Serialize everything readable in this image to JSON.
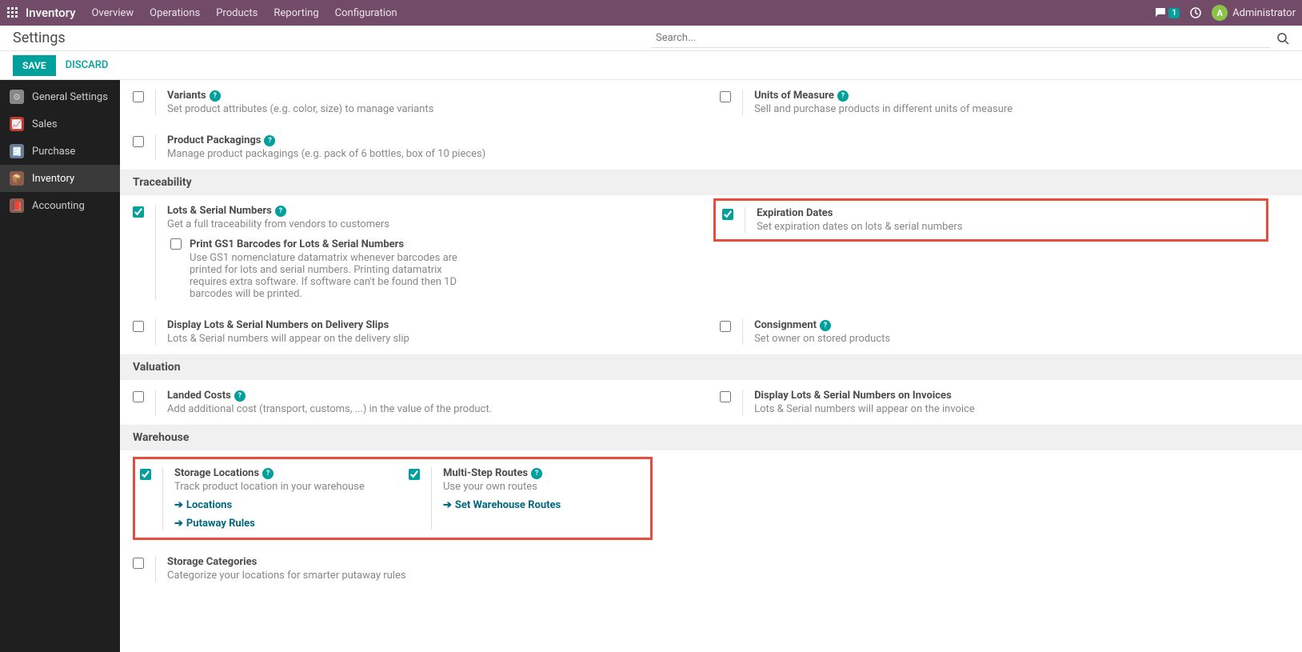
{
  "topbar": {
    "brand": "Inventory",
    "menu": [
      "Overview",
      "Operations",
      "Products",
      "Reporting",
      "Configuration"
    ],
    "badge_count": "1",
    "user": "Administrator",
    "avatar_letter": "A"
  },
  "page": {
    "title": "Settings",
    "search_placeholder": "Search..."
  },
  "actions": {
    "save": "SAVE",
    "discard": "DISCARD"
  },
  "sidebar": {
    "items": [
      {
        "label": "General Settings"
      },
      {
        "label": "Sales"
      },
      {
        "label": "Purchase"
      },
      {
        "label": "Inventory"
      },
      {
        "label": "Accounting"
      }
    ]
  },
  "products": {
    "variants": {
      "title": "Variants",
      "desc": "Set product attributes (e.g. color, size) to manage variants"
    },
    "uom": {
      "title": "Units of Measure",
      "desc": "Sell and purchase products in different units of measure"
    },
    "packagings": {
      "title": "Product Packagings",
      "desc": "Manage product packagings (e.g. pack of 6 bottles, box of 10 pieces)"
    }
  },
  "sections": {
    "traceability": "Traceability",
    "valuation": "Valuation",
    "warehouse": "Warehouse"
  },
  "traceability": {
    "lots": {
      "title": "Lots & Serial Numbers",
      "desc": "Get a full traceability from vendors to customers"
    },
    "gs1": {
      "title": "Print GS1 Barcodes for Lots & Serial Numbers",
      "desc": "Use GS1 nomenclature datamatrix whenever barcodes are printed for lots and serial numbers. Printing datamatrix requires extra software. If software can't be found then 1D barcodes will be printed."
    },
    "expiration": {
      "title": "Expiration Dates",
      "desc": "Set expiration dates on lots & serial numbers"
    },
    "display_slips": {
      "title": "Display Lots & Serial Numbers on Delivery Slips",
      "desc": "Lots & Serial numbers will appear on the delivery slip"
    },
    "consignment": {
      "title": "Consignment",
      "desc": "Set owner on stored products"
    }
  },
  "valuation": {
    "landed": {
      "title": "Landed Costs",
      "desc": "Add additional cost (transport, customs, ...) in the value of the product."
    },
    "display_inv": {
      "title": "Display Lots & Serial Numbers on Invoices",
      "desc": "Lots & Serial numbers will appear on the invoice"
    }
  },
  "warehouse": {
    "storage_loc": {
      "title": "Storage Locations",
      "desc": "Track product location in your warehouse"
    },
    "locations_link": "Locations",
    "putaway_link": "Putaway Rules",
    "routes": {
      "title": "Multi-Step Routes",
      "desc": "Use your own routes"
    },
    "routes_link": "Set Warehouse Routes",
    "storage_cat": {
      "title": "Storage Categories",
      "desc": "Categorize your locations for smarter putaway rules"
    }
  }
}
